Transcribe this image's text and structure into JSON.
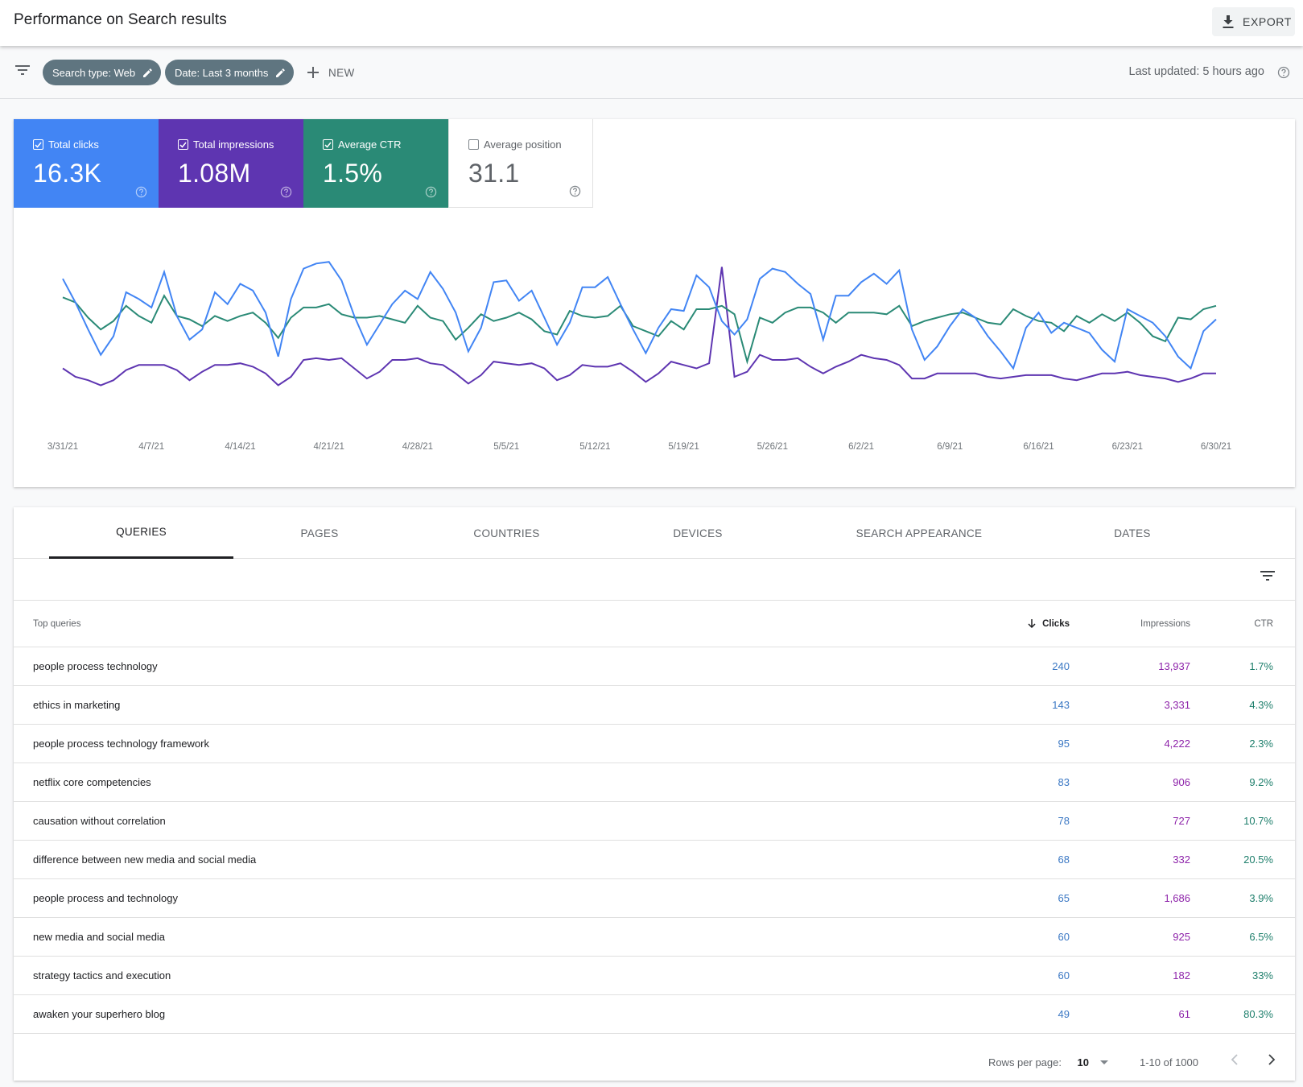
{
  "header": {
    "title": "Performance on Search results",
    "export_label": "EXPORT"
  },
  "filters": {
    "chips": [
      {
        "label": "Search type: Web"
      },
      {
        "label": "Date: Last 3 months"
      }
    ],
    "new_label": "NEW",
    "last_updated": "Last updated: 5 hours ago"
  },
  "metrics": [
    {
      "label": "Total clicks",
      "value": "16.3K",
      "checked": true,
      "color": "#4285f4"
    },
    {
      "label": "Total impressions",
      "value": "1.08M",
      "checked": true,
      "color": "#5e35b1"
    },
    {
      "label": "Average CTR",
      "value": "1.5%",
      "checked": true,
      "color": "#2a8a76"
    },
    {
      "label": "Average position",
      "value": "31.1",
      "checked": false,
      "color": "#ffffff"
    }
  ],
  "chart_data": {
    "type": "line",
    "title": "",
    "xlabel": "",
    "ylabel": "",
    "y_scale_note": "each series uses its own hidden axis; values normalized 0-100 (relative height)",
    "ylim": [
      0,
      100
    ],
    "grid": false,
    "legend": "none",
    "x_start": "3/31/21",
    "x_end": "6/30/21",
    "x_tick_labels": [
      "3/31/21",
      "4/7/21",
      "4/14/21",
      "4/21/21",
      "4/28/21",
      "5/5/21",
      "5/12/21",
      "5/19/21",
      "5/26/21",
      "6/2/21",
      "6/9/21",
      "6/16/21",
      "6/23/21",
      "6/30/21"
    ],
    "series": [
      {
        "name": "Total clicks",
        "color": "#4285f4",
        "values": [
          78,
          64,
          48,
          33,
          44,
          70,
          66,
          61,
          82,
          56,
          42,
          48,
          70,
          63,
          75,
          71,
          58,
          32,
          66,
          84,
          87,
          88,
          77,
          56,
          39,
          51,
          63,
          71,
          66,
          82,
          72,
          58,
          35,
          49,
          76,
          77,
          65,
          71,
          55,
          39,
          52,
          73,
          73,
          79,
          63,
          48,
          34,
          49,
          60,
          59,
          80,
          73,
          53,
          45,
          54,
          78,
          84,
          82,
          75,
          69,
          42,
          68,
          68,
          76,
          81,
          75,
          83,
          48,
          30,
          38,
          50,
          60,
          55,
          44,
          35,
          25,
          49,
          58,
          46,
          52,
          49,
          46,
          36,
          29,
          60,
          56,
          52,
          44,
          32,
          25,
          47,
          54
        ]
      },
      {
        "name": "Total impressions",
        "color": "#5e35b1",
        "values": [
          25,
          20,
          18,
          15,
          18,
          24,
          27,
          27,
          27,
          24,
          18,
          23,
          27,
          27,
          28,
          26,
          22,
          15,
          20,
          30,
          31,
          30,
          31,
          25,
          19,
          23,
          30,
          30,
          31,
          28,
          27,
          22,
          16,
          21,
          29,
          28,
          27,
          28,
          25,
          18,
          21,
          27,
          26,
          26,
          28,
          23,
          17,
          22,
          29,
          27,
          25,
          28,
          85,
          20,
          23,
          33,
          30,
          30,
          31,
          26,
          22,
          26,
          29,
          33,
          31,
          30,
          27,
          19,
          19,
          22,
          22,
          22,
          22,
          20,
          19,
          20,
          21,
          21,
          21,
          19,
          18,
          20,
          22,
          22,
          23,
          21,
          20,
          19,
          17,
          19,
          22,
          22
        ]
      },
      {
        "name": "Average CTR",
        "color": "#2a8a76",
        "values": [
          67,
          64,
          55,
          48,
          53,
          62,
          56,
          52,
          68,
          56,
          54,
          50,
          56,
          53,
          56,
          58,
          52,
          43,
          55,
          61,
          61,
          63,
          57,
          55,
          55,
          56,
          54,
          52,
          62,
          55,
          53,
          42,
          49,
          57,
          53,
          55,
          58,
          54,
          47,
          45,
          59,
          56,
          55,
          56,
          62,
          50,
          47,
          44,
          53,
          48,
          60,
          60,
          62,
          57,
          29,
          55,
          52,
          58,
          61,
          61,
          58,
          52,
          58,
          58,
          58,
          57,
          62,
          50,
          53,
          55,
          57,
          58,
          55,
          52,
          51,
          60,
          56,
          53,
          52,
          47,
          56,
          52,
          57,
          53,
          58,
          52,
          44,
          41,
          55,
          54,
          60,
          62
        ]
      }
    ]
  },
  "tabs": [
    {
      "label": "QUERIES",
      "active": true
    },
    {
      "label": "PAGES",
      "active": false
    },
    {
      "label": "COUNTRIES",
      "active": false
    },
    {
      "label": "DEVICES",
      "active": false
    },
    {
      "label": "SEARCH APPEARANCE",
      "active": false
    },
    {
      "label": "DATES",
      "active": false
    }
  ],
  "table": {
    "columns": {
      "query": "Top queries",
      "clicks": "Clicks",
      "impressions": "Impressions",
      "ctr": "CTR"
    },
    "sort": {
      "column": "clicks",
      "direction": "desc"
    },
    "rows": [
      {
        "query": "people process technology",
        "clicks": "240",
        "impressions": "13,937",
        "ctr": "1.7%"
      },
      {
        "query": "ethics in marketing",
        "clicks": "143",
        "impressions": "3,331",
        "ctr": "4.3%"
      },
      {
        "query": "people process technology framework",
        "clicks": "95",
        "impressions": "4,222",
        "ctr": "2.3%"
      },
      {
        "query": "netflix core competencies",
        "clicks": "83",
        "impressions": "906",
        "ctr": "9.2%"
      },
      {
        "query": "causation without correlation",
        "clicks": "78",
        "impressions": "727",
        "ctr": "10.7%"
      },
      {
        "query": "difference between new media and social media",
        "clicks": "68",
        "impressions": "332",
        "ctr": "20.5%"
      },
      {
        "query": "people process and technology",
        "clicks": "65",
        "impressions": "1,686",
        "ctr": "3.9%"
      },
      {
        "query": "new media and social media",
        "clicks": "60",
        "impressions": "925",
        "ctr": "6.5%"
      },
      {
        "query": "strategy tactics and execution",
        "clicks": "60",
        "impressions": "182",
        "ctr": "33%"
      },
      {
        "query": "awaken your superhero blog",
        "clicks": "49",
        "impressions": "61",
        "ctr": "80.3%"
      }
    ]
  },
  "pagination": {
    "rows_per_page_label": "Rows per page:",
    "rows_per_page": "10",
    "range": "1-10 of 1000"
  }
}
